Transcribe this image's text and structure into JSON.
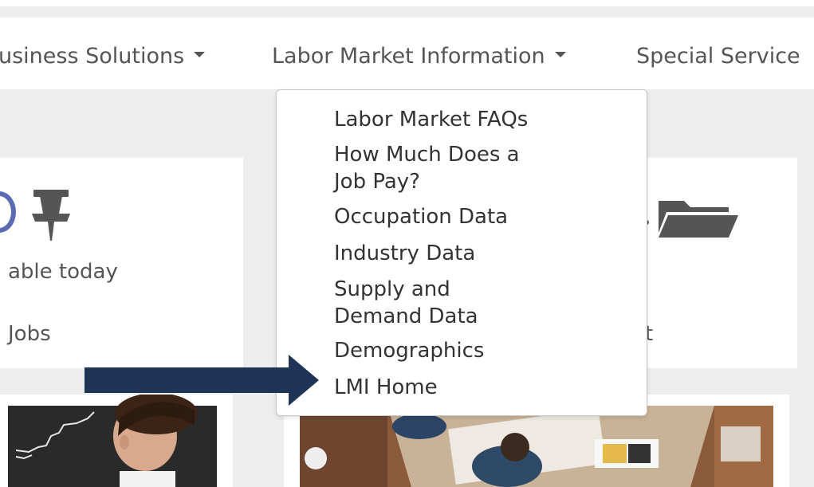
{
  "nav": {
    "items": [
      {
        "label": "usiness Solutions",
        "has_dropdown": true
      },
      {
        "label": "Labor Market Information",
        "has_dropdown": true
      },
      {
        "label": "Special Service",
        "has_dropdown": false
      }
    ]
  },
  "dropdown": {
    "items": [
      {
        "label": "Labor Market FAQs"
      },
      {
        "label": "How Much Does a\nJob Pay?"
      },
      {
        "label": "Occupation Data"
      },
      {
        "label": "Industry Data"
      },
      {
        "label": "Supply and\nDemand Data"
      },
      {
        "label": "Demographics"
      },
      {
        "label": "LMI Home"
      }
    ]
  },
  "cards": {
    "left": {
      "text_1": "able today",
      "text_2": "Jobs",
      "icon": "pushpin-icon"
    },
    "right": {
      "text": "t",
      "icon": "folder-open-icon"
    }
  },
  "colors": {
    "page_bg": "#eeeeee",
    "nav_text": "#555555",
    "dropdown_text": "#333333",
    "arrow": "#1f3557",
    "pin": "#555555",
    "circle_accent": "#5a6bb3"
  },
  "annotation": {
    "arrow_target": "LMI Home"
  }
}
